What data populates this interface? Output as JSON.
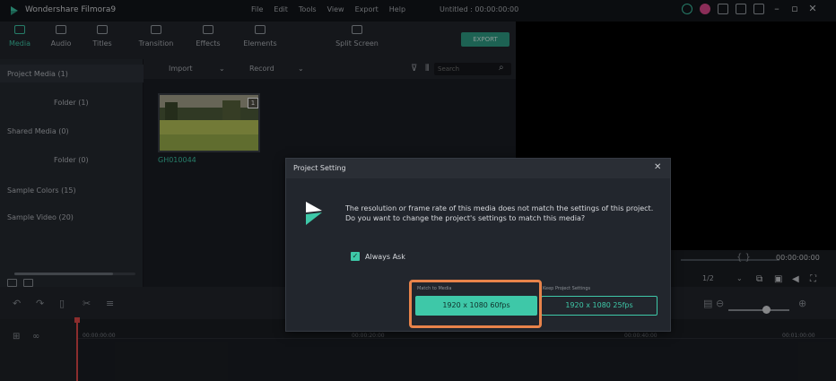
{
  "app": {
    "name": "Wondershare Filmora9",
    "document_title": "Untitled : 00:00:00:00",
    "menus": [
      "File",
      "Edit",
      "Tools",
      "View",
      "Export",
      "Help"
    ]
  },
  "toolbar": {
    "tabs": [
      {
        "label": "Media",
        "icon": "folder-icon",
        "active": true
      },
      {
        "label": "Audio",
        "icon": "music-note-icon",
        "active": false
      },
      {
        "label": "Titles",
        "icon": "text-icon",
        "active": false
      },
      {
        "label": "Transition",
        "icon": "transition-icon",
        "active": false
      },
      {
        "label": "Effects",
        "icon": "effects-icon",
        "active": false
      },
      {
        "label": "Elements",
        "icon": "elements-icon",
        "active": false
      },
      {
        "label": "Split Screen",
        "icon": "split-screen-icon",
        "active": false
      }
    ],
    "export_label": "EXPORT"
  },
  "media_panel": {
    "items": [
      {
        "label": "Project Media (1)",
        "indent": false,
        "selected": true
      },
      {
        "label": "Folder (1)",
        "indent": true,
        "selected": false
      },
      {
        "label": "Shared Media (0)",
        "indent": false,
        "selected": false
      },
      {
        "label": "Folder (0)",
        "indent": true,
        "selected": false
      },
      {
        "label": "Sample Colors (15)",
        "indent": false,
        "selected": false
      },
      {
        "label": "Sample Video (20)",
        "indent": false,
        "selected": false
      }
    ]
  },
  "browser": {
    "import_label": "Import",
    "record_label": "Record",
    "search_placeholder": "Search",
    "clip": {
      "name": "GH010044",
      "badge": "1"
    }
  },
  "playback": {
    "timecode": "00:00:00:00",
    "ratio": "1/2"
  },
  "timeline": {
    "timecodes": [
      "00:00:00:00",
      "00:00:20:00",
      "00:00:40:00",
      "00:01:00:00"
    ]
  },
  "dialog": {
    "title": "Project Setting",
    "message": "The resolution or frame rate of this media does not match the settings of this project. Do you want to change the project's settings to match this media?",
    "always_ask_label": "Always Ask",
    "always_ask_checked": true,
    "button_media_caption": "Match to Media",
    "button_media_label": "1920 x 1080 60fps",
    "button_project_caption": "Keep Project Settings",
    "button_project_label": "1920 x 1080 25fps"
  },
  "colors": {
    "accent": "#3ec8a8",
    "highlight": "#e8834a",
    "playhead": "#e04a4a"
  }
}
